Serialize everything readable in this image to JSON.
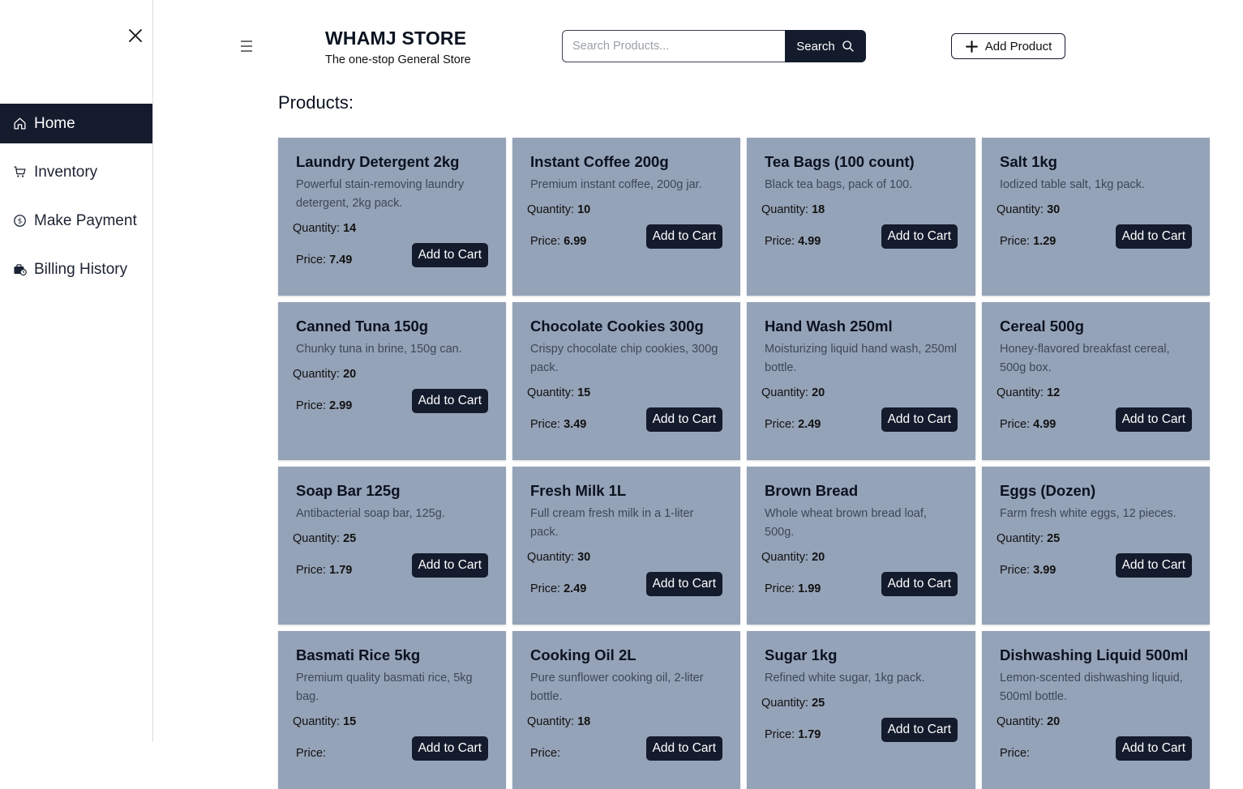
{
  "sidebar": {
    "items": [
      {
        "label": "Home",
        "icon": "home-icon",
        "active": true
      },
      {
        "label": "Inventory",
        "icon": "cart-icon",
        "active": false
      },
      {
        "label": "Make Payment",
        "icon": "dollar-circle-icon",
        "active": false
      },
      {
        "label": "Billing History",
        "icon": "briefcase-clock-icon",
        "active": false
      }
    ]
  },
  "header": {
    "title": "WHAMJ STORE",
    "subtitle": "The one-stop General Store",
    "search_placeholder": "Search Products...",
    "search_value": "",
    "search_label": "Search",
    "add_product_label": "Add Product"
  },
  "main": {
    "section_title": "Products:",
    "quantity_label": "Quantity:",
    "price_label": "Price:",
    "cart_label": "Add to Cart",
    "products": [
      {
        "name": "Laundry Detergent 2kg",
        "desc": "Powerful stain-removing laundry detergent, 2kg pack.",
        "qty": "14",
        "price": "7.49"
      },
      {
        "name": "Instant Coffee 200g",
        "desc": "Premium instant coffee, 200g jar.",
        "qty": "10",
        "price": "6.99"
      },
      {
        "name": "Tea Bags (100 count)",
        "desc": "Black tea bags, pack of 100.",
        "qty": "18",
        "price": "4.99"
      },
      {
        "name": "Salt 1kg",
        "desc": "Iodized table salt, 1kg pack.",
        "qty": "30",
        "price": "1.29"
      },
      {
        "name": "Canned Tuna 150g",
        "desc": "Chunky tuna in brine, 150g can.",
        "qty": "20",
        "price": "2.99"
      },
      {
        "name": "Chocolate Cookies 300g",
        "desc": "Crispy chocolate chip cookies, 300g pack.",
        "qty": "15",
        "price": "3.49"
      },
      {
        "name": "Hand Wash 250ml",
        "desc": "Moisturizing liquid hand wash, 250ml bottle.",
        "qty": "20",
        "price": "2.49"
      },
      {
        "name": "Cereal 500g",
        "desc": "Honey-flavored breakfast cereal, 500g box.",
        "qty": "12",
        "price": "4.99"
      },
      {
        "name": "Soap Bar 125g",
        "desc": "Antibacterial soap bar, 125g.",
        "qty": "25",
        "price": "1.79"
      },
      {
        "name": "Fresh Milk 1L",
        "desc": "Full cream fresh milk in a 1-liter pack.",
        "qty": "30",
        "price": "2.49"
      },
      {
        "name": "Brown Bread",
        "desc": "Whole wheat brown bread loaf, 500g.",
        "qty": "20",
        "price": "1.99"
      },
      {
        "name": "Eggs (Dozen)",
        "desc": "Farm fresh white eggs, 12 pieces.",
        "qty": "25",
        "price": "3.99"
      },
      {
        "name": "Basmati Rice 5kg",
        "desc": "Premium quality basmati rice, 5kg bag.",
        "qty": "15",
        "price": ""
      },
      {
        "name": "Cooking Oil 2L",
        "desc": "Pure sunflower cooking oil, 2-liter bottle.",
        "qty": "18",
        "price": ""
      },
      {
        "name": "Sugar 1kg",
        "desc": "Refined white sugar, 1kg pack.",
        "qty": "25",
        "price": "1.79"
      },
      {
        "name": "Dishwashing Liquid 500ml",
        "desc": "Lemon-scented dishwashing liquid, 500ml bottle.",
        "qty": "20",
        "price": ""
      }
    ]
  },
  "colors": {
    "accent": "#141b2d",
    "card_bg": "#95a3b8",
    "card_desc": "#3d4758"
  }
}
